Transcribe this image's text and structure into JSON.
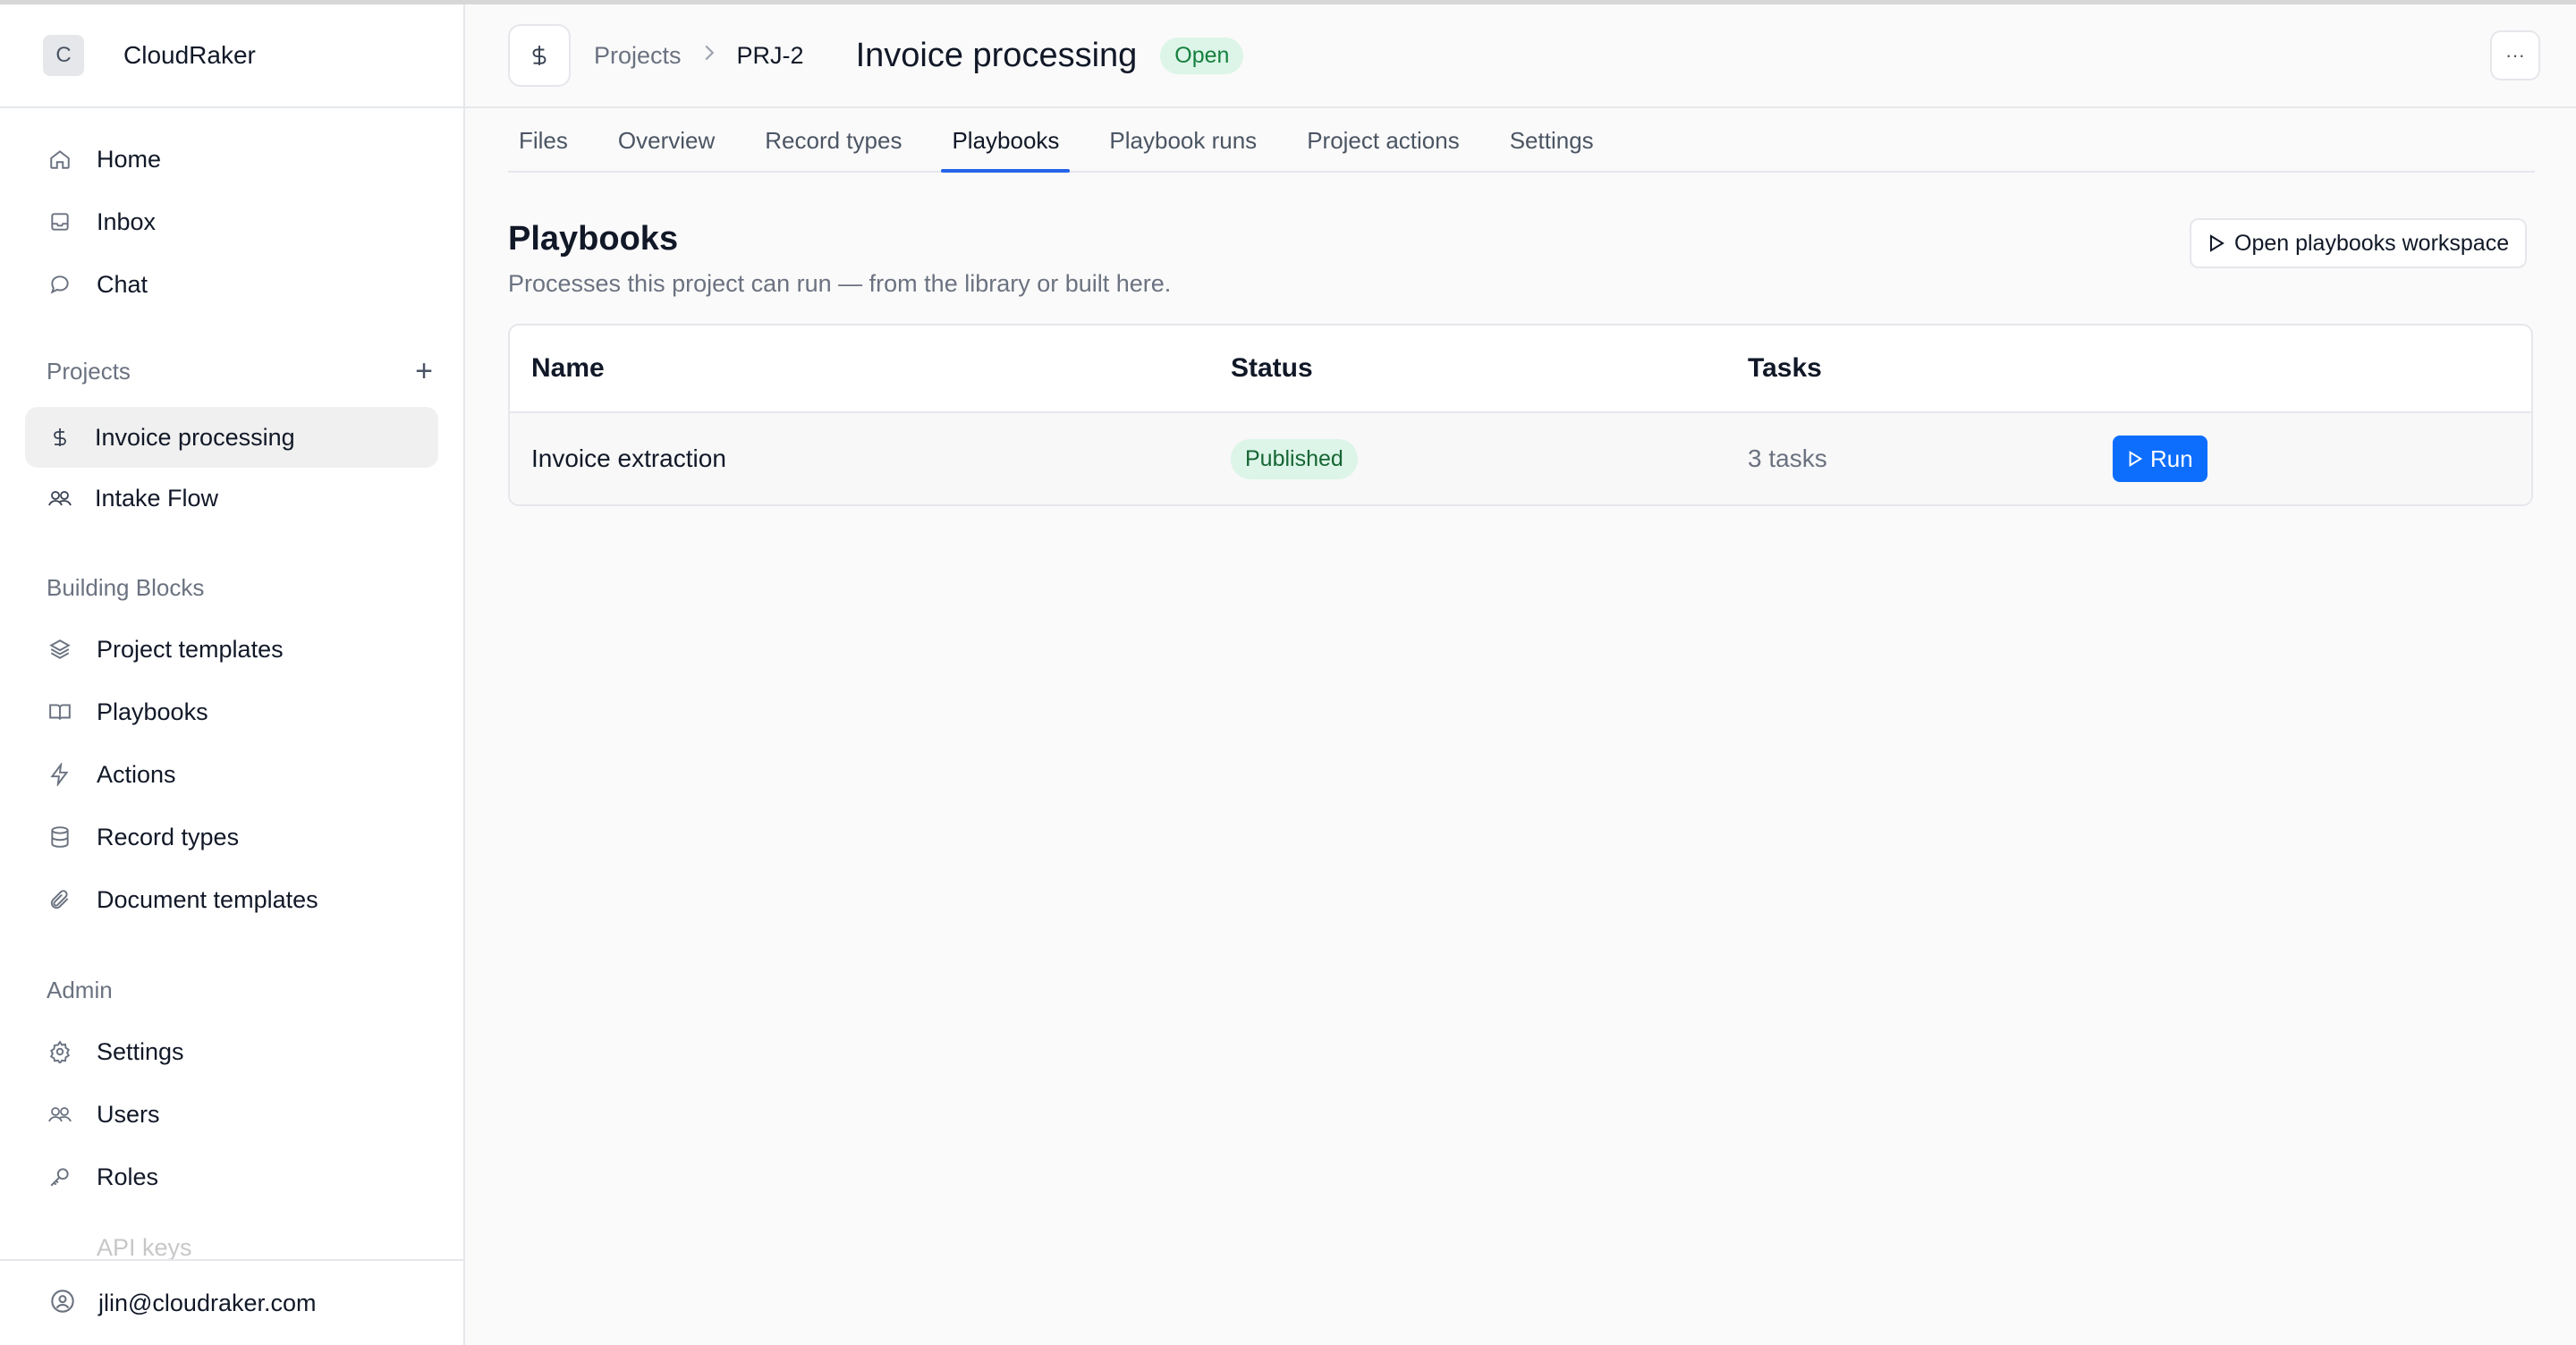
{
  "brand": {
    "logo_letter": "C",
    "name": "CloudRaker"
  },
  "nav": {
    "main": [
      {
        "label": "Home",
        "icon": "home-icon"
      },
      {
        "label": "Inbox",
        "icon": "inbox-icon"
      },
      {
        "label": "Chat",
        "icon": "chat-icon"
      }
    ],
    "projects_heading": "Projects",
    "projects": [
      {
        "label": "Invoice processing",
        "icon": "dollar-icon",
        "active": true
      },
      {
        "label": "Intake Flow",
        "icon": "users-icon",
        "active": false
      }
    ],
    "building_blocks_heading": "Building Blocks",
    "building_blocks": [
      {
        "label": "Project templates",
        "icon": "layers-icon"
      },
      {
        "label": "Playbooks",
        "icon": "book-icon"
      },
      {
        "label": "Actions",
        "icon": "bolt-icon"
      },
      {
        "label": "Record types",
        "icon": "database-icon"
      },
      {
        "label": "Document templates",
        "icon": "paperclip-icon"
      }
    ],
    "admin_heading": "Admin",
    "admin": [
      {
        "label": "Settings",
        "icon": "gear-icon"
      },
      {
        "label": "Users",
        "icon": "users-icon"
      },
      {
        "label": "Roles",
        "icon": "key-icon"
      }
    ],
    "partially_hidden_item": "API keys",
    "user_email": "jlin@cloudraker.com"
  },
  "header": {
    "breadcrumb_root": "Projects",
    "project_id": "PRJ-2",
    "title": "Invoice processing",
    "status": "Open"
  },
  "tabs": [
    "Files",
    "Overview",
    "Record types",
    "Playbooks",
    "Playbook runs",
    "Project actions",
    "Settings"
  ],
  "active_tab": "Playbooks",
  "section": {
    "title": "Playbooks",
    "description": "Processes this project can run — from the library or built here.",
    "open_workspace_label": "Open playbooks workspace"
  },
  "table": {
    "headers": [
      "Name",
      "Status",
      "Tasks"
    ],
    "rows": [
      {
        "name": "Invoice extraction",
        "status": "Published",
        "tasks": "3 tasks",
        "action": "Run"
      }
    ]
  },
  "colors": {
    "accent": "#0d6efd",
    "tab_underline": "#2563eb",
    "status_green_bg": "#dcf5e8",
    "status_green_text": "#15803d"
  }
}
